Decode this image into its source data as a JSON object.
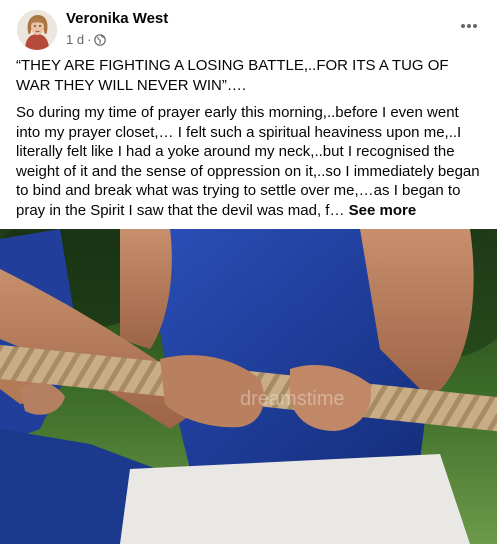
{
  "post": {
    "author": "Veronika West",
    "timestamp": "1 d",
    "audience_icon": "globe-icon",
    "more_icon": "more-horizontal-icon",
    "headline": "“THEY ARE FIGHTING A LOSING BATTLE,..FOR ITS A TUG OF WAR THEY WILL NEVER WIN”….",
    "body": "So during my time of prayer early this morning,..before I even went into my prayer closet,… I felt such a spiritual heaviness upon me,..I literally felt like I had a yoke around my neck,..but I recognised the weight of it and the sense of oppression on it,..so I immediately began to bind and break what was trying to settle over me,…as I began to pray in the Spirit I saw that the devil was mad, f…",
    "see_more": "See more",
    "image": {
      "subject": "hands-pulling-rope-photo",
      "watermark": "dreamstime"
    }
  },
  "colors": {
    "text_primary": "#050505",
    "text_secondary": "#65676b",
    "background": "#ffffff",
    "shirt_blue": "#1f3f9c",
    "grass_green": "#3f6e2a",
    "rope": "#c9ad86"
  }
}
